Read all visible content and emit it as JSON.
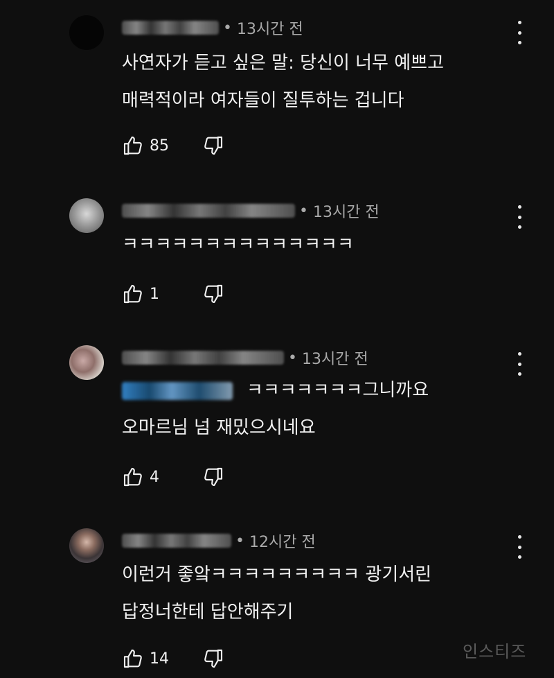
{
  "comments": [
    {
      "time": "13시간 전",
      "lines": [
        "사연자가 듣고 싶은 말: 당신이 너무 예쁘고",
        "매력적이라 여자들이 질투하는 겁니다"
      ],
      "likes": "85"
    },
    {
      "time": "13시간 전",
      "lines": [
        "ㅋㅋㅋㅋㅋㅋㅋㅋㅋㅋㅋㅋㅋㅋ"
      ],
      "likes": "1"
    },
    {
      "time": "13시간 전",
      "lines": [
        "ㅋㅋㅋㅋㅋㅋㅋ그니까요",
        "오마르님 넘 재밌으시네요"
      ],
      "likes": "4"
    },
    {
      "time": "12시간 전",
      "lines": [
        "이런거 좋앜ㅋㅋㅋㅋㅋㅋㅋㅋㅋ 광기서린",
        "답정너한테 답안해주기"
      ],
      "likes": "14"
    }
  ],
  "watermark": "인스티즈",
  "icons": {
    "like": "thumbs-up-icon",
    "dislike": "thumbs-down-icon",
    "more": "more-vertical-icon"
  },
  "colors": {
    "background": "#0f0f0f",
    "text": "#f1f1f1",
    "meta": "#aaaaaa",
    "mention": "#3ea6ff"
  }
}
